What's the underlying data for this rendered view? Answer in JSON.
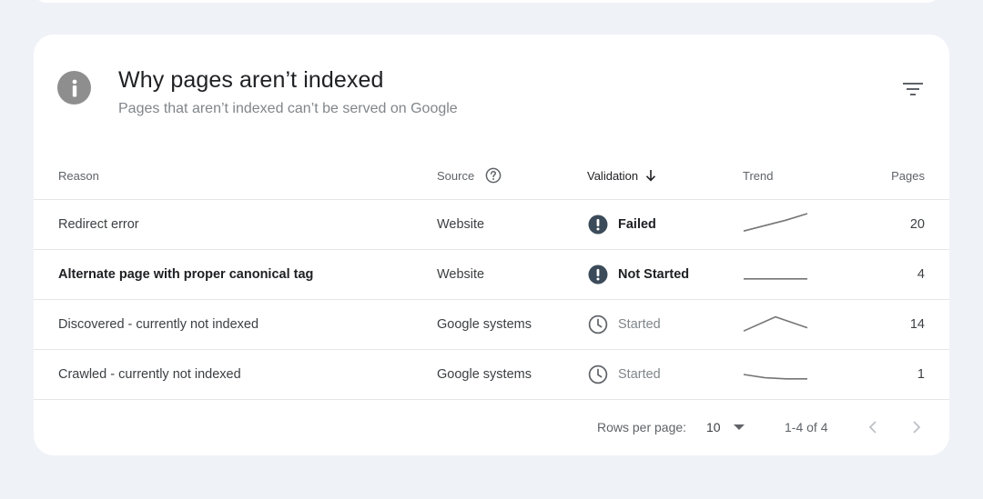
{
  "header": {
    "title": "Why pages aren’t indexed",
    "subtitle": "Pages that aren’t indexed can’t be served on Google",
    "info_icon": "info-icon",
    "filter_icon": "filter-icon"
  },
  "table": {
    "columns": {
      "reason": "Reason",
      "source": "Source",
      "validation": "Validation",
      "trend": "Trend",
      "pages": "Pages"
    },
    "rows": [
      {
        "reason": "Redirect error",
        "source": "Website",
        "validation": "Failed",
        "validation_icon": "alert-icon",
        "pages": "20",
        "trend": [
          0.2,
          0.45,
          0.7,
          1.0
        ]
      },
      {
        "reason": "Alternate page with proper canonical tag",
        "source": "Website",
        "validation": "Not Started",
        "validation_icon": "alert-icon",
        "pages": "4",
        "trend": [
          0.3,
          0.3,
          0.3,
          0.3
        ]
      },
      {
        "reason": "Discovered - currently not indexed",
        "source": "Google systems",
        "validation": "Started",
        "validation_icon": "clock-icon",
        "pages": "14",
        "trend": [
          0.2,
          0.85,
          0.35
        ]
      },
      {
        "reason": "Crawled - currently not indexed",
        "source": "Google systems",
        "validation": "Started",
        "validation_icon": "clock-icon",
        "pages": "1",
        "trend": [
          0.5,
          0.35,
          0.3,
          0.3
        ]
      }
    ]
  },
  "footer": {
    "rows_per_page_label": "Rows per page:",
    "rows_per_page_value": "10",
    "range": "1-4 of 4"
  },
  "colors": {
    "background": "#eff2f7",
    "card": "#ffffff",
    "status_icon": "#3c4b5a",
    "trend_line": "#757575"
  }
}
